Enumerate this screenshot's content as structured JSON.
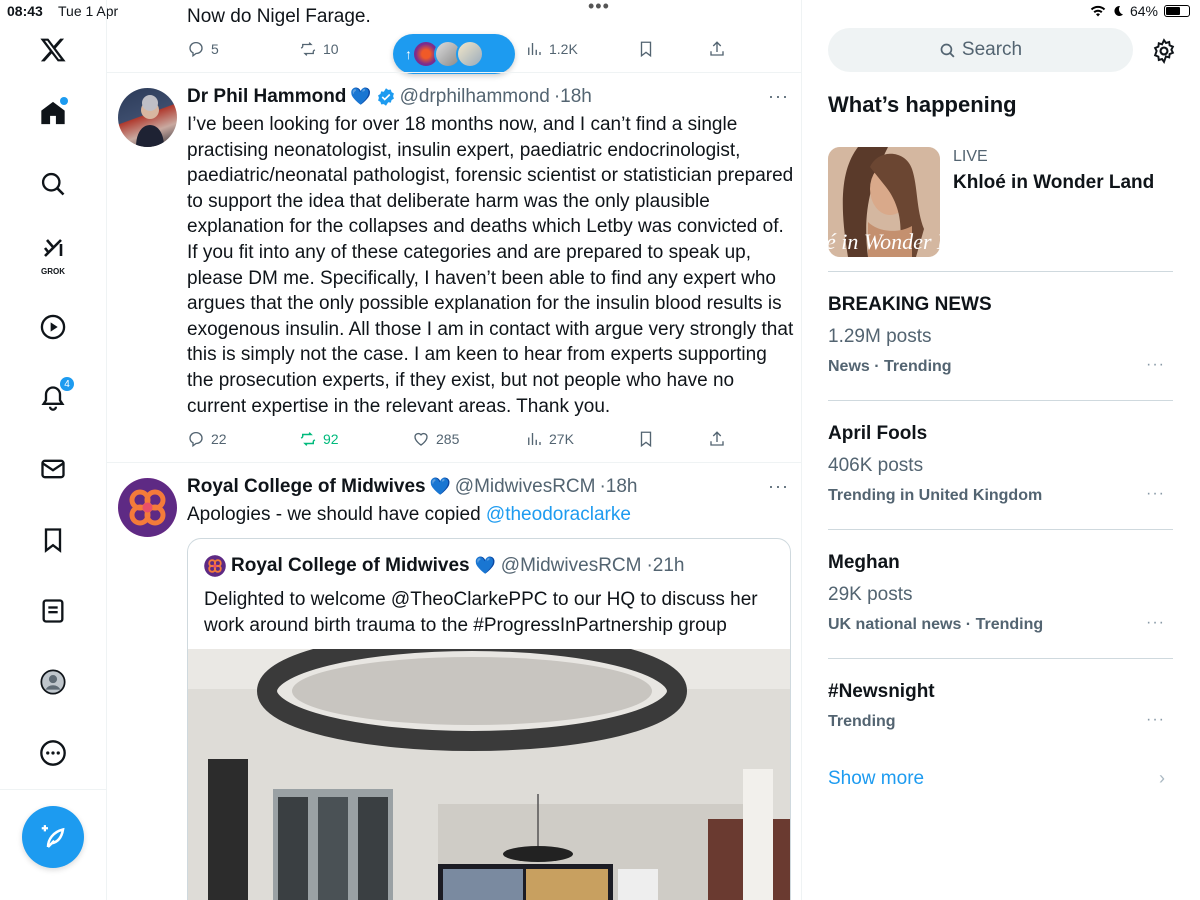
{
  "status_bar": {
    "time": "08:43",
    "date": "Tue 1 Apr",
    "battery": "64%"
  },
  "nav": {
    "grok_label": "GROK",
    "notifications_count": "4"
  },
  "timeline": {
    "previous_tweet": {
      "text": "Now do Nigel Farage.",
      "replies": "5",
      "reposts": "10",
      "views": "1.2K"
    },
    "new_posts_pill": {
      "arrow": "↑"
    },
    "tweets": [
      {
        "name": "Dr Phil Hammond",
        "heart": "💙",
        "handle": "@drphilhammond",
        "time": "·18h",
        "text": "I’ve been looking for over 18 months now, and I can’t find a single practising neonatologist, insulin expert, paediatric endocrinologist, paediatric/neonatal pathologist, forensic scientist or statistician prepared to support the idea that deliberate harm was the only plausible explanation for the collapses and deaths which Letby was convicted of. If you fit into any of these categories and are prepared to speak up, please DM me. Specifically, I haven’t been able to find any expert who argues that the only possible explanation for the insulin blood results is exogenous insulin. All those I am in contact with argue very strongly that this is simply not the case. I am keen to hear from experts supporting the prosecution experts, if they exist, but not people who have no current expertise in the relevant areas. Thank you.",
        "replies": "22",
        "reposts": "92",
        "likes": "285",
        "views": "27K"
      },
      {
        "name": "Royal College of Midwives",
        "heart": "💙",
        "handle": "@MidwivesRCM",
        "time": "·18h",
        "text": "Apologies - we should have copied ",
        "mention": "@theodoraclarke",
        "quote": {
          "name": "Royal College of Midwives",
          "heart": "💙",
          "handle": "@MidwivesRCM",
          "time": "·21h",
          "text": "Delighted to welcome @TheoClarkePPC to our HQ to discuss her work around birth trauma to the #ProgressInPartnership group"
        }
      }
    ],
    "more_glyph": "···"
  },
  "sidebar": {
    "search_placeholder": "Search",
    "whats_happening": "What’s happening",
    "featured": {
      "badge": "LIVE",
      "title": "Khloé in Wonder Land",
      "image_text": "é in Wonder L"
    },
    "trends": [
      {
        "title": "BREAKING NEWS",
        "posts": "1.29M posts",
        "meta": "News · Trending"
      },
      {
        "title": "April Fools",
        "posts": "406K posts",
        "meta": "Trending in United Kingdom"
      },
      {
        "title": "Meghan",
        "posts": "29K posts",
        "meta": "UK national news · Trending"
      },
      {
        "title": "#Newsnight",
        "posts": "",
        "meta": "Trending"
      }
    ],
    "show_more": "Show more",
    "more_glyph": "···"
  },
  "colors": {
    "accent": "#1d9bf0",
    "repost_green": "#00ba7c",
    "muted": "#536471"
  },
  "icons": [
    "x-logo-icon",
    "home-icon",
    "search-icon",
    "grok-icon",
    "video-icon",
    "bell-icon",
    "mail-icon",
    "bookmark-icon",
    "list-icon",
    "profile-icon",
    "more-icon",
    "compose-icon",
    "reply-icon",
    "repost-icon",
    "like-icon",
    "views-icon",
    "share-icon",
    "gear-icon",
    "wifi-icon",
    "moon-icon",
    "battery-icon"
  ]
}
